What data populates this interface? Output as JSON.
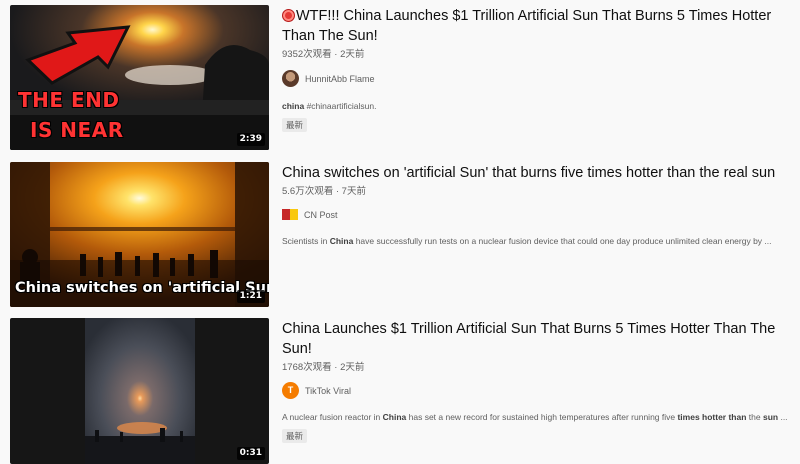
{
  "results": [
    {
      "title": "WTF!!! China Launches $1 Trillion Artificial Sun That Burns 5 Times Hotter Than The Sun!",
      "views": "9352次观看",
      "age": "2天前",
      "channel": "HunnitAbb Flame",
      "desc_parts": [
        "china",
        " #chinaartificialsun."
      ],
      "badge": "最新",
      "duration": "2:39",
      "thumb_caption_line1": "THE END",
      "thumb_caption_line2": "IS NEAR"
    },
    {
      "title": "China switches on 'artificial Sun' that burns five times hotter than the real sun",
      "views": "5.6万次观看",
      "age": "7天前",
      "channel": "CN Post",
      "desc_parts": [
        "Scientists in ",
        "China",
        " have successfully run tests on a nuclear fusion device that could one day produce unlimited clean energy by ..."
      ],
      "duration": "1:21",
      "thumb_caption": "China switches on 'artificial Sun'"
    },
    {
      "title": "China Launches $1 Trillion Artificial Sun That Burns 5 Times Hotter Than The Sun!",
      "views": "1768次观看",
      "age": "2天前",
      "channel": "TikTok Viral",
      "avatar_letter": "T",
      "desc_parts": [
        "A nuclear fusion reactor in ",
        "China",
        " has set a new record for sustained high temperatures after running five ",
        "times hotter than",
        " the ",
        "sun",
        " ..."
      ],
      "badge": "最新",
      "duration": "0:31"
    }
  ],
  "colors": {
    "background": "#f9f9f9",
    "title": "#0f0f0f",
    "meta": "#606060",
    "live_dot": "#e53935",
    "avatar_tiktok": "#f57c00"
  }
}
